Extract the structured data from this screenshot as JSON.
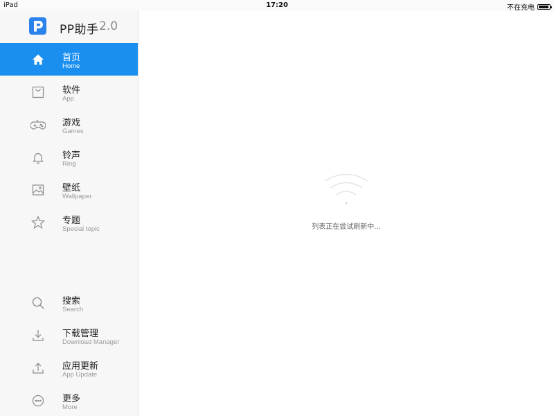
{
  "status_bar": {
    "device": "iPad",
    "time": "17:20",
    "charging_text": "不在充电",
    "battery_level": 0.9
  },
  "app": {
    "name": "PP助手",
    "version": "2.0",
    "brand_color": "#2a83ea",
    "active_color": "#1a8ff0"
  },
  "nav": {
    "primary": [
      {
        "id": "home",
        "title": "首页",
        "subtitle": "Home",
        "icon": "home-icon",
        "active": true
      },
      {
        "id": "app",
        "title": "软件",
        "subtitle": "App",
        "icon": "shopping-bag-icon",
        "active": false
      },
      {
        "id": "games",
        "title": "游戏",
        "subtitle": "Games",
        "icon": "gamepad-icon",
        "active": false
      },
      {
        "id": "ring",
        "title": "铃声",
        "subtitle": "Ring",
        "icon": "bell-icon",
        "active": false
      },
      {
        "id": "wallpaper",
        "title": "壁纸",
        "subtitle": "Wallpaper",
        "icon": "image-icon",
        "active": false
      },
      {
        "id": "special",
        "title": "专题",
        "subtitle": "Special topic",
        "icon": "star-icon",
        "active": false
      }
    ],
    "secondary": [
      {
        "id": "search",
        "title": "搜索",
        "subtitle": "Search",
        "icon": "search-icon"
      },
      {
        "id": "download",
        "title": "下载管理",
        "subtitle": "Download Manager",
        "icon": "download-icon"
      },
      {
        "id": "update",
        "title": "应用更新",
        "subtitle": "App Update",
        "icon": "upload-icon"
      },
      {
        "id": "more",
        "title": "更多",
        "subtitle": "More",
        "icon": "more-icon"
      }
    ]
  },
  "main": {
    "loading_icon": "wifi-signal-icon",
    "loading_text": "列表正在尝试刷新中..."
  }
}
